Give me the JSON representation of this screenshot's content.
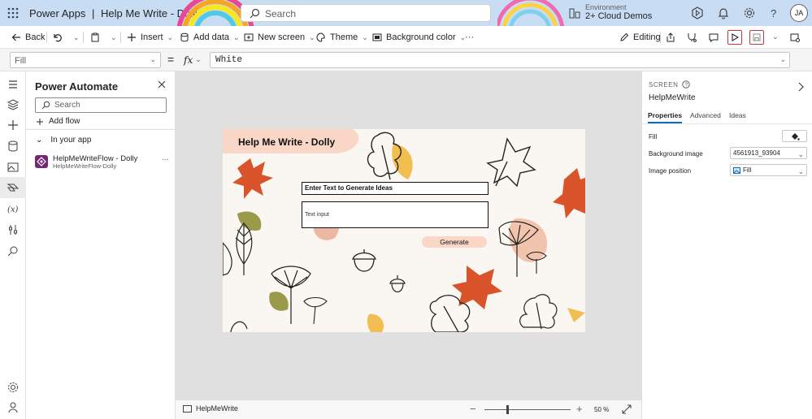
{
  "titlebar": {
    "product": "Power Apps",
    "separator": "|",
    "app_name": "Help Me Write - Dolly",
    "search_placeholder": "Search",
    "environment_label": "Environment",
    "environment_value": "2+ Cloud Demos",
    "avatar_initials": "JA"
  },
  "commandbar": {
    "back": "Back",
    "insert": "Insert",
    "add_data": "Add data",
    "new_screen": "New screen",
    "theme": "Theme",
    "background_color": "Background color",
    "more": "···",
    "editing": "Editing"
  },
  "formulabar": {
    "property": "Fill",
    "equals": "=",
    "fx": "fx",
    "formula": "White"
  },
  "flyout": {
    "title": "Power Automate",
    "search_placeholder": "Search",
    "add_flow": "Add flow",
    "section": "In your app",
    "flow_name": "HelpMeWriteFlow - Dolly",
    "flow_sub": "HelpMeWriteFlow-Dolly",
    "flow_more": "..."
  },
  "app_screen": {
    "title": "Help Me Write - Dolly",
    "label": "Enter Text to Generate Ideas",
    "input_placeholder": "Text input",
    "button": "Generate"
  },
  "statusbar": {
    "screen_name": "HelpMeWrite",
    "zoom_minus": "−",
    "zoom_plus": "+",
    "zoom_value": "50  %",
    "zoom_level": 0.5
  },
  "properties": {
    "kind": "SCREEN",
    "name": "HelpMeWrite",
    "tabs": [
      "Properties",
      "Advanced",
      "Ideas"
    ],
    "rows": [
      {
        "label": "Fill",
        "value": ""
      },
      {
        "label": "Background image",
        "value": "4561913_93904"
      },
      {
        "label": "Image position",
        "value": "Fill"
      }
    ]
  },
  "colors": {
    "titlebar_bg": "#c8dcf3",
    "accent": "#0f6cbd",
    "highlight": "#d13438",
    "leaf_orange": "#d9542a",
    "leaf_yellow": "#f2be52",
    "leaf_olive": "#9a9a4a",
    "leaf_peach": "#f2c4ad"
  }
}
